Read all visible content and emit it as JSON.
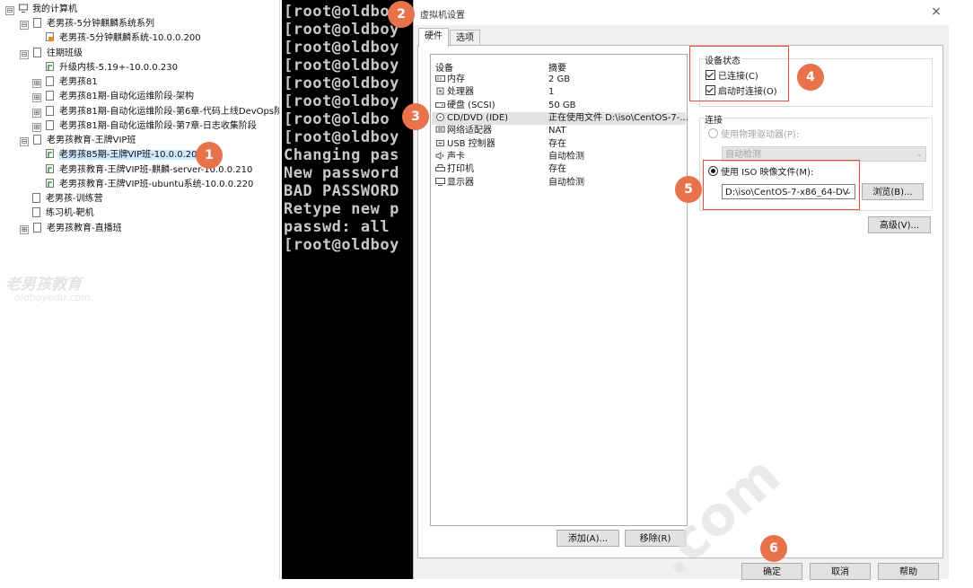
{
  "tree": {
    "items": [
      {
        "label": "我的计算机",
        "expander": "⊟",
        "icon": "computer-icon"
      },
      {
        "label": "老男孩-5分钟麒麟系统系列",
        "expander": "⊟",
        "icon": "folder-icon"
      },
      {
        "label": "老男孩-5分钟麒麟系统-10.0.0.200",
        "expander": "",
        "icon": "vm-icon"
      },
      {
        "label": "往期班级",
        "expander": "⊟",
        "icon": "folder-icon"
      },
      {
        "label": "升级内核-5.19+-10.0.0.230",
        "expander": "",
        "icon": "vm-icon"
      },
      {
        "label": "老男孩81",
        "expander": "⊞",
        "icon": "folder-icon"
      },
      {
        "label": "老男孩81期-自动化运维阶段-架构",
        "expander": "⊞",
        "icon": "folder-icon"
      },
      {
        "label": "老男孩81期-自动化运维阶段-第6章-代码上线DevOps阶",
        "expander": "⊞",
        "icon": "folder-icon"
      },
      {
        "label": "老男孩81期-自动化运维阶段-第7章-日志收集阶段",
        "expander": "⊞",
        "icon": "folder-icon"
      },
      {
        "label": "老男孩教育-王牌VIP班",
        "expander": "⊟",
        "icon": "folder-icon"
      },
      {
        "label": "老男孩85期-王牌VIP班-10.0.0.200",
        "expander": "",
        "icon": "vm-icon"
      },
      {
        "label": "老男孩教育-王牌VIP班-麒麟-server-10.0.0.210",
        "expander": "",
        "icon": "vm-icon"
      },
      {
        "label": "老男孩教育-王牌VIP班-ubuntu系统-10.0.0.220",
        "expander": "",
        "icon": "vm-icon"
      },
      {
        "label": "老男孩-训练营",
        "expander": "",
        "icon": "folder-icon"
      },
      {
        "label": "练习机-靶机",
        "expander": "",
        "icon": "folder-icon"
      },
      {
        "label": "老男孩教育-直播班",
        "expander": "⊞",
        "icon": "folder-icon"
      }
    ],
    "watermark": {
      "logo": "老男孩教育",
      "sub": "oldboyedu.com"
    }
  },
  "terminal": {
    "lines": [
      "[root@oldboy",
      "[root@oldboy",
      "[root@oldboy",
      "[root@oldboy",
      "[root@oldboy",
      "[root@oldboy",
      "[root@oldbo",
      "[root@oldboy",
      "Changing pas",
      "New password",
      "BAD PASSWORD",
      "Retype new p",
      "passwd: all ",
      "[root@oldboy"
    ]
  },
  "dialog": {
    "title": "虚拟机设置",
    "close": "×",
    "tabs": [
      "硬件",
      "选项"
    ],
    "device_list": {
      "headers": [
        "设备",
        "摘要"
      ],
      "rows": [
        {
          "name": "内存",
          "summary": "2 GB",
          "icon": "memory-icon"
        },
        {
          "name": "处理器",
          "summary": "1",
          "icon": "cpu-icon"
        },
        {
          "name": "硬盘 (SCSI)",
          "summary": "50 GB",
          "icon": "disk-icon"
        },
        {
          "name": "CD/DVD (IDE)",
          "summary": "正在使用文件 D:\\iso\\CentOS-7-...",
          "icon": "cd-icon"
        },
        {
          "name": "网络适配器",
          "summary": "NAT",
          "icon": "network-icon"
        },
        {
          "name": "USB 控制器",
          "summary": "存在",
          "icon": "usb-icon"
        },
        {
          "name": "声卡",
          "summary": "自动检测",
          "icon": "sound-icon"
        },
        {
          "name": "打印机",
          "summary": "存在",
          "icon": "printer-icon"
        },
        {
          "name": "显示器",
          "summary": "自动检测",
          "icon": "display-icon"
        }
      ]
    },
    "add_button": "添加(A)...",
    "remove_button": "移除(R)",
    "device_status": {
      "title": "设备状态",
      "connected": "已连接(C)",
      "connect_on_power": "启动时连接(O)"
    },
    "connection": {
      "title": "连接",
      "physical_drive": "使用物理驱动器(P):",
      "physical_value": "自动检测",
      "iso_option": "使用 ISO 映像文件(M):",
      "iso_path": "D:\\iso\\CentOS-7-x86_64-DV",
      "browse": "浏览(B)..."
    },
    "advanced_button": "高级(V)...",
    "ok_button": "确定",
    "cancel_button": "取消",
    "help_button": "帮助"
  },
  "annotations": [
    "1",
    "2",
    "3",
    "4",
    "5",
    "6"
  ],
  "watermark_text": ".com",
  "colors": {
    "marker": "#e8734a",
    "highlight_box": "#e0503a",
    "terminal_bg": "#000000",
    "selected_row": "#cde8ff"
  }
}
